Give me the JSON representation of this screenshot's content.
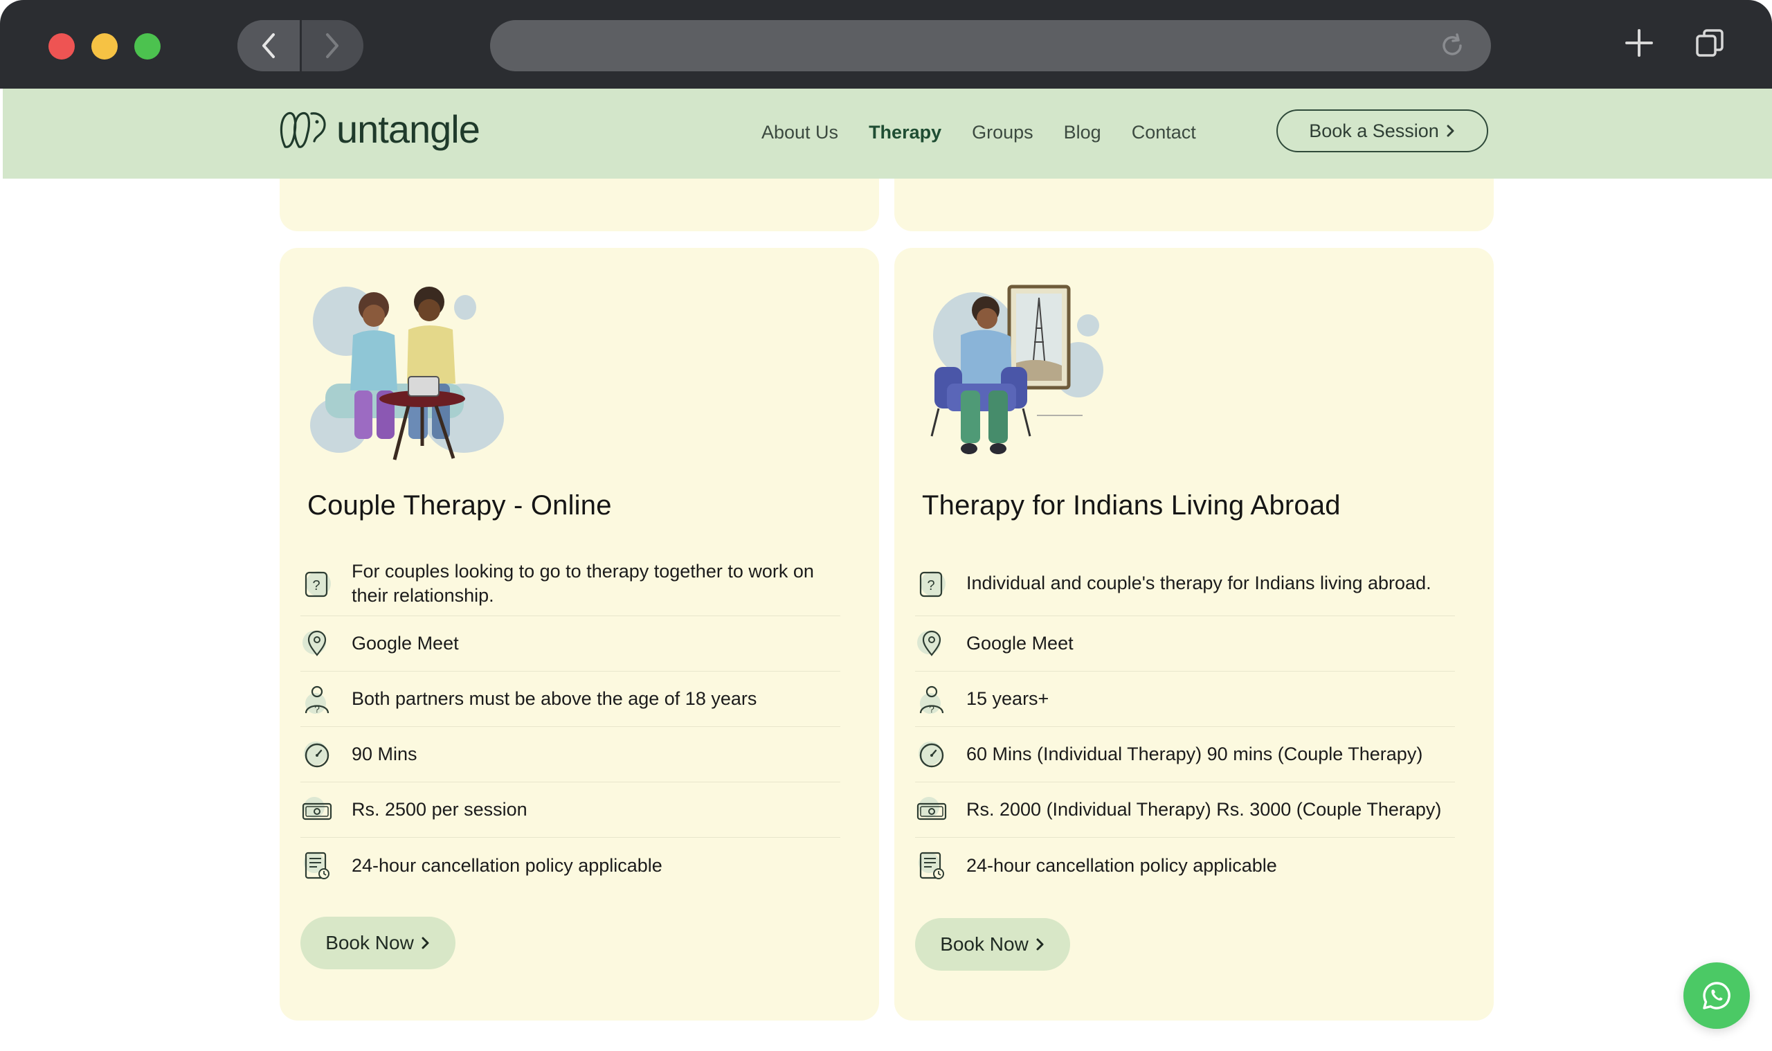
{
  "browser": {
    "url": ""
  },
  "site": {
    "logo_text": "untangle",
    "nav": [
      {
        "label": "About Us",
        "active": false
      },
      {
        "label": "Therapy",
        "active": true
      },
      {
        "label": "Groups",
        "active": false
      },
      {
        "label": "Blog",
        "active": false
      },
      {
        "label": "Contact",
        "active": false
      }
    ],
    "cta_label": "Book a Session"
  },
  "cards": [
    {
      "title": "Couple Therapy - Online",
      "rows": [
        {
          "icon": "question-icon",
          "text": "For couples looking to go to therapy together to work on their relationship."
        },
        {
          "icon": "location-pin-icon",
          "text": "Google Meet"
        },
        {
          "icon": "person-icon",
          "text": "Both partners must be above the age of 18 years"
        },
        {
          "icon": "clock-icon",
          "text": "90 Mins"
        },
        {
          "icon": "cash-icon",
          "text": "Rs. 2500 per session"
        },
        {
          "icon": "policy-document-icon",
          "text": "24-hour cancellation policy applicable"
        }
      ],
      "button_label": "Book Now"
    },
    {
      "title": "Therapy for Indians Living Abroad",
      "rows": [
        {
          "icon": "question-icon",
          "text": "Individual and couple's therapy for Indians living abroad."
        },
        {
          "icon": "location-pin-icon",
          "text": "Google Meet"
        },
        {
          "icon": "person-icon",
          "text": "15 years+"
        },
        {
          "icon": "clock-icon",
          "text": "60 Mins (Individual Therapy) 90 mins (Couple Therapy)"
        },
        {
          "icon": "cash-icon",
          "text": "Rs. 2000 (Individual Therapy) Rs. 3000 (Couple Therapy)"
        },
        {
          "icon": "policy-document-icon",
          "text": "24-hour cancellation policy applicable"
        }
      ],
      "button_label": "Book Now"
    }
  ],
  "colors": {
    "header_bg": "#d3e6ca",
    "card_bg": "#fcf9df",
    "button_bg": "#d8e7c7",
    "whatsapp": "#4bc965",
    "brand_text": "#1f3a2b"
  }
}
